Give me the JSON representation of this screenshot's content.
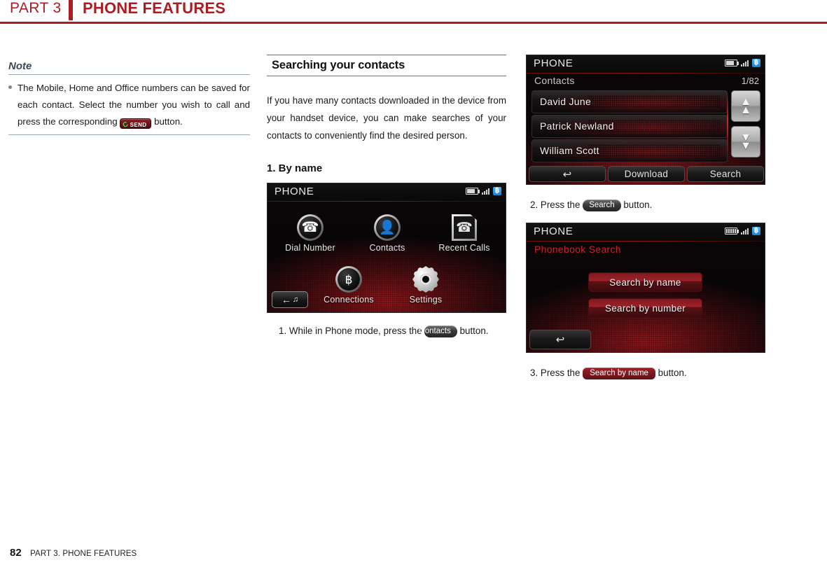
{
  "header": {
    "part_label": "PART 3",
    "title": "PHONE FEATURES"
  },
  "note": {
    "title": "Note",
    "bullet_text_1": "The Mobile, Home and Office numbers can be saved for each contact. Select the number you wish to call and press the corresponding",
    "send_button_label": "SEND",
    "bullet_text_2": "button."
  },
  "section": {
    "title": "Searching your contacts",
    "paragraph": "If you have many contacts downloaded in the device from your handset device, you can make searches of your contacts to conveniently find the desired person.",
    "step_heading": "1. By name"
  },
  "phone_home_screen": {
    "title": "PHONE",
    "status_icons": [
      "battery-icon",
      "signal-icon",
      "bluetooth-icon"
    ],
    "bluetooth_glyph": "฿",
    "apps": [
      {
        "label": "Dial Number",
        "icon": "dial-number-icon",
        "glyph": "☎"
      },
      {
        "label": "Contacts",
        "icon": "contacts-icon",
        "glyph": "@"
      },
      {
        "label": "Recent Calls",
        "icon": "recent-calls-icon",
        "glyph": "☎"
      },
      {
        "label": "Connections",
        "icon": "connections-bluetooth-icon",
        "glyph": "฿"
      },
      {
        "label": "Settings",
        "icon": "settings-gear-icon",
        "glyph": ""
      }
    ],
    "back_button": {
      "icon": "back-arrow-media-icon",
      "arrow": "←",
      "note": "♫"
    }
  },
  "contacts_screen": {
    "title": "PHONE",
    "subtitle": "Contacts",
    "counter": "1/82",
    "contacts": [
      "David June",
      "Patrick Newland",
      "William Scott"
    ],
    "scroll_up": "▲",
    "scroll_down": "▼",
    "bottom_buttons": [
      {
        "label": "↩",
        "name": "back-button"
      },
      {
        "label": "Download",
        "name": "download-button"
      },
      {
        "label": "Search",
        "name": "search-button"
      }
    ]
  },
  "phonebook_search_screen": {
    "title": "PHONE",
    "subtitle": "Phonebook Search",
    "buttons": [
      "Search by name",
      "Search by number"
    ],
    "back_glyph": "↩"
  },
  "captions": {
    "step1_pre": "1. While in Phone mode, press the",
    "step1_pill": "Contacts",
    "step1_post": "button.",
    "step2_pre": "2. Press the",
    "step2_pill": "Search",
    "step2_post": "button.",
    "step3_pre": "3. Press the",
    "step3_pill": "Search by name",
    "step3_post": "button."
  },
  "footer": {
    "page_number": "82",
    "text": "PART 3. PHONE FEATURES"
  },
  "colors": {
    "brand_red": "#A81E23",
    "screen_red": "#C4262C",
    "bluetooth_blue": "#1D7FD0"
  }
}
